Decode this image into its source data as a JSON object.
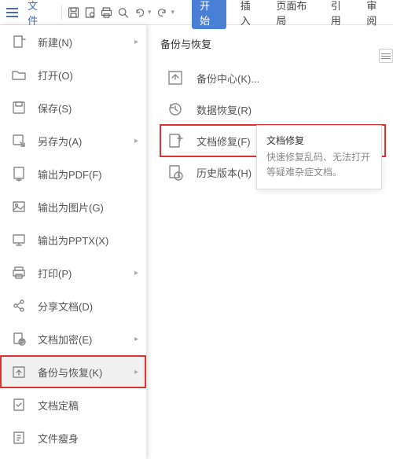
{
  "topbar": {
    "file_label": "文件"
  },
  "tabs": {
    "start": "开始",
    "insert": "插入",
    "layout": "页面布局",
    "reference": "引用",
    "review": "审阅"
  },
  "file_menu": {
    "items": [
      {
        "label": "新建(N)",
        "arrow": true
      },
      {
        "label": "打开(O)"
      },
      {
        "label": "保存(S)"
      },
      {
        "label": "另存为(A)",
        "arrow": true
      },
      {
        "label": "输出为PDF(F)"
      },
      {
        "label": "输出为图片(G)"
      },
      {
        "label": "输出为PPTX(X)"
      },
      {
        "label": "打印(P)",
        "arrow": true
      },
      {
        "label": "分享文档(D)"
      },
      {
        "label": "文档加密(E)",
        "arrow": true
      },
      {
        "label": "备份与恢复(K)",
        "arrow": true
      },
      {
        "label": "文档定稿"
      },
      {
        "label": "文件瘦身"
      }
    ]
  },
  "submenu": {
    "title": "备份与恢复",
    "items": [
      {
        "label": "备份中心(K)..."
      },
      {
        "label": "数据恢复(R)"
      },
      {
        "label": "文档修复(F)"
      },
      {
        "label": "历史版本(H)"
      }
    ]
  },
  "tooltip": {
    "title": "文档修复",
    "body": "快速修复乱码、无法打开等疑难杂症文档。"
  }
}
